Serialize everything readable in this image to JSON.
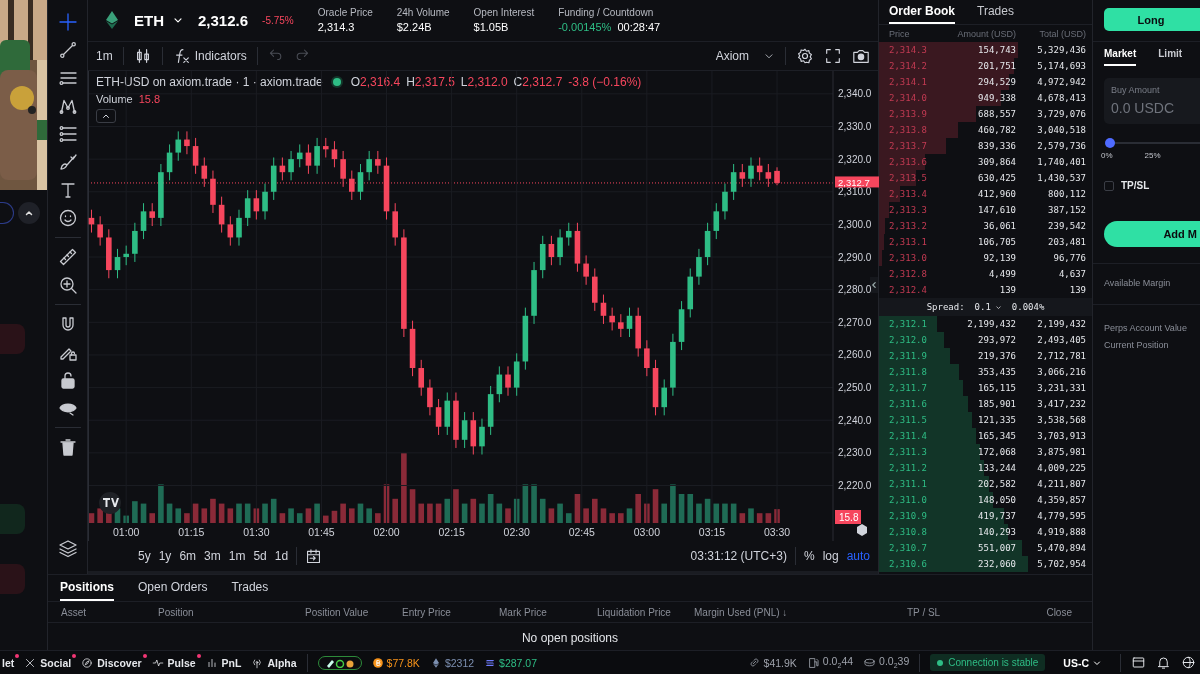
{
  "left_panel": {
    "thumbnail": {
      "kind": "picture"
    }
  },
  "market": {
    "symbol": "ETH",
    "price": "2,312.6",
    "change": "-5.75%",
    "stats": [
      {
        "label": "Oracle Price",
        "value": "2,314.3",
        "kind": "plain"
      },
      {
        "label": "24h Volume",
        "value": "$2.24B",
        "kind": "plain"
      },
      {
        "label": "Open Interest",
        "value": "$1.05B",
        "kind": "plain"
      },
      {
        "label": "Funding / Countdown",
        "value": "-0.00145%",
        "kind": "funding",
        "extra": "00:28:47"
      }
    ]
  },
  "toolbar": {
    "interval": "1m",
    "indicators": "Indicators",
    "layout": "Axiom"
  },
  "tool_groups": [
    [
      {
        "kind": "crosshair",
        "selected": true
      },
      {
        "kind": "line",
        "selected": false
      },
      {
        "kind": "hlines",
        "selected": false
      },
      {
        "kind": "pattern",
        "selected": false
      },
      {
        "kind": "fib",
        "selected": false
      },
      {
        "kind": "brush",
        "selected": false
      },
      {
        "kind": "text",
        "selected": false
      },
      {
        "kind": "smile",
        "selected": false
      }
    ],
    [
      {
        "kind": "ruler",
        "selected": false
      },
      {
        "kind": "zoom",
        "selected": false
      }
    ],
    [
      {
        "kind": "magnet",
        "selected": false
      },
      {
        "kind": "pencil-lock",
        "selected": false
      },
      {
        "kind": "lock",
        "selected": false
      },
      {
        "kind": "eye",
        "selected": false
      }
    ],
    [
      {
        "kind": "trash",
        "selected": false
      }
    ]
  ],
  "bottom_tools": [
    {
      "kind": "layers",
      "selected": false
    }
  ],
  "legend": {
    "title": "ETH-USD on axiom.trade · 1 · axiom.trade",
    "ohlc": [
      {
        "key": "O",
        "value": "2,316.4"
      },
      {
        "key": "H",
        "value": "2,317.5"
      },
      {
        "key": "L",
        "value": "2,312.0"
      },
      {
        "key": "C",
        "value": "2,312.7"
      }
    ],
    "change": "-3.8 (−0.16%)",
    "volume_label": "Volume",
    "volume_value": "15.8"
  },
  "chart": {
    "price_tag": "2,312.7",
    "volume_tag": "15.8",
    "chart_data": {
      "type": "candlestick",
      "grid": true,
      "ylim": [
        2203,
        2347
      ],
      "xlim": [
        51.2,
        222.9
      ],
      "x": [
        52,
        54,
        56,
        58,
        60,
        62,
        64,
        66,
        68,
        70,
        72,
        74,
        76,
        78,
        80,
        82,
        84,
        86,
        88,
        90,
        92,
        94,
        96,
        98,
        100,
        102,
        104,
        106,
        108,
        110,
        112,
        114,
        116,
        118,
        120,
        122,
        124,
        126,
        128,
        130,
        132,
        134,
        136,
        138,
        140,
        142,
        144,
        146,
        148,
        150,
        152,
        154,
        156,
        158,
        160,
        162,
        164,
        166,
        168,
        170,
        172,
        174,
        176,
        178,
        180,
        182,
        184,
        186,
        188,
        190,
        192,
        194,
        196,
        198,
        200,
        202,
        204,
        206,
        208,
        210
      ],
      "ohlc": [
        [
          2302,
          2304.5,
          2297.5,
          2300
        ],
        [
          2300,
          2302.5,
          2293.5,
          2296
        ],
        [
          2296,
          2298.5,
          2283.5,
          2286
        ],
        [
          2286,
          2292.5,
          2283.5,
          2290
        ],
        [
          2290,
          2293.5,
          2287.5,
          2291
        ],
        [
          2291,
          2300.5,
          2288.5,
          2298
        ],
        [
          2298,
          2306.5,
          2295.5,
          2304
        ],
        [
          2304,
          2306.5,
          2299.5,
          2302
        ],
        [
          2302,
          2318.5,
          2299.5,
          2316
        ],
        [
          2316,
          2324.5,
          2313.5,
          2322
        ],
        [
          2322,
          2328.5,
          2319.5,
          2326
        ],
        [
          2326,
          2328.5,
          2321.5,
          2324
        ],
        [
          2324,
          2326.5,
          2315.5,
          2318
        ],
        [
          2318,
          2320.5,
          2311.5,
          2314
        ],
        [
          2314,
          2316.5,
          2303.5,
          2306
        ],
        [
          2306,
          2308.5,
          2297.5,
          2300
        ],
        [
          2300,
          2302.5,
          2293.5,
          2296
        ],
        [
          2296,
          2304.5,
          2293.5,
          2302
        ],
        [
          2302,
          2310.5,
          2299.5,
          2308
        ],
        [
          2308,
          2310.5,
          2301.5,
          2304
        ],
        [
          2304,
          2312.5,
          2301.5,
          2310
        ],
        [
          2310,
          2320.5,
          2307.5,
          2318
        ],
        [
          2318,
          2320.5,
          2313.5,
          2316
        ],
        [
          2316,
          2322.5,
          2313.5,
          2320
        ],
        [
          2320,
          2324.5,
          2317.5,
          2322
        ],
        [
          2322,
          2324.5,
          2315.5,
          2318
        ],
        [
          2318,
          2326.5,
          2315.5,
          2324
        ],
        [
          2324,
          2326.5,
          2320.5,
          2323
        ],
        [
          2323,
          2325.5,
          2317.5,
          2320
        ],
        [
          2320,
          2322.5,
          2311.5,
          2314
        ],
        [
          2314,
          2316.5,
          2307.5,
          2310
        ],
        [
          2310,
          2318.5,
          2307.5,
          2316
        ],
        [
          2316,
          2322.5,
          2313.5,
          2320
        ],
        [
          2320,
          2322.5,
          2315.5,
          2318
        ],
        [
          2318,
          2320.5,
          2301.5,
          2304
        ],
        [
          2304,
          2306.5,
          2293.5,
          2296
        ],
        [
          2296,
          2298.5,
          2265.5,
          2268
        ],
        [
          2268,
          2270.5,
          2253.5,
          2256
        ],
        [
          2256,
          2258.5,
          2247.5,
          2250
        ],
        [
          2250,
          2252.5,
          2241.5,
          2244
        ],
        [
          2244,
          2246.5,
          2235.5,
          2238
        ],
        [
          2238,
          2248.5,
          2235.5,
          2246
        ],
        [
          2246,
          2248.5,
          2231.5,
          2234
        ],
        [
          2234,
          2242.5,
          2231.5,
          2240
        ],
        [
          2240,
          2242.5,
          2229.5,
          2232
        ],
        [
          2232,
          2240.5,
          2229.5,
          2238
        ],
        [
          2238,
          2250.5,
          2235.5,
          2248
        ],
        [
          2248,
          2256.5,
          2245.5,
          2254
        ],
        [
          2254,
          2256.5,
          2247.5,
          2250
        ],
        [
          2250,
          2260.5,
          2247.5,
          2258
        ],
        [
          2258,
          2274.5,
          2255.5,
          2272
        ],
        [
          2272,
          2288.5,
          2269.5,
          2286
        ],
        [
          2286,
          2296.5,
          2283.5,
          2294
        ],
        [
          2294,
          2296.5,
          2287.5,
          2290
        ],
        [
          2290,
          2298.5,
          2287.5,
          2296
        ],
        [
          2296,
          2300.5,
          2293.5,
          2298
        ],
        [
          2298,
          2300.5,
          2285.5,
          2288
        ],
        [
          2288,
          2290.5,
          2281.5,
          2284
        ],
        [
          2284,
          2286.5,
          2273.5,
          2276
        ],
        [
          2276,
          2278.5,
          2269.5,
          2272
        ],
        [
          2272,
          2274.5,
          2267.5,
          2270
        ],
        [
          2270,
          2272.5,
          2265.5,
          2268
        ],
        [
          2268,
          2274.5,
          2265.5,
          2272
        ],
        [
          2272,
          2274.5,
          2259.5,
          2262
        ],
        [
          2262,
          2264.5,
          2253.5,
          2256
        ],
        [
          2256,
          2258.5,
          2241.5,
          2244
        ],
        [
          2244,
          2252.5,
          2241.5,
          2250
        ],
        [
          2250,
          2266.5,
          2247.5,
          2264
        ],
        [
          2264,
          2276.5,
          2261.5,
          2274
        ],
        [
          2274,
          2286.5,
          2271.5,
          2284
        ],
        [
          2284,
          2292.5,
          2281.5,
          2290
        ],
        [
          2290,
          2300.5,
          2287.5,
          2298
        ],
        [
          2298,
          2306.5,
          2295.5,
          2304
        ],
        [
          2304,
          2312.5,
          2301.5,
          2310
        ],
        [
          2310,
          2318.5,
          2307.5,
          2316
        ],
        [
          2316,
          2318.5,
          2311.5,
          2314
        ],
        [
          2314,
          2320.5,
          2311.5,
          2318
        ],
        [
          2318,
          2320.5,
          2313.5,
          2316
        ],
        [
          2316,
          2318.5,
          2311.5,
          2314
        ],
        [
          2316.4,
          2317.5,
          2312.0,
          2312.7
        ]
      ],
      "yticks": [
        {
          "value": 2340,
          "label": "2,340.0"
        },
        {
          "value": 2330,
          "label": "2,330.0"
        },
        {
          "value": 2320,
          "label": "2,320.0"
        },
        {
          "value": 2310,
          "label": "2,310.0"
        },
        {
          "value": 2300,
          "label": "2,300.0"
        },
        {
          "value": 2290,
          "label": "2,290.0"
        },
        {
          "value": 2280,
          "label": "2,280.0"
        },
        {
          "value": 2270,
          "label": "2,270.0"
        },
        {
          "value": 2260,
          "label": "2,260.0"
        },
        {
          "value": 2250,
          "label": "2,250.0"
        },
        {
          "value": 2240,
          "label": "2,240.0"
        },
        {
          "value": 2230,
          "label": "2,230.0"
        },
        {
          "value": 2220,
          "label": "2,220.0"
        }
      ],
      "xticks": [
        {
          "value": 60,
          "label": "01:00"
        },
        {
          "value": 75,
          "label": "01:15"
        },
        {
          "value": 90,
          "label": "01:30"
        },
        {
          "value": 105,
          "label": "01:45"
        },
        {
          "value": 120,
          "label": "02:00"
        },
        {
          "value": 135,
          "label": "02:15"
        },
        {
          "value": 150,
          "label": "02:30"
        },
        {
          "value": 165,
          "label": "02:45"
        },
        {
          "value": 180,
          "label": "03:00"
        },
        {
          "value": 195,
          "label": "03:15"
        },
        {
          "value": 210,
          "label": "03:30"
        }
      ]
    }
  },
  "range_bar": {
    "ranges": [
      "5y",
      "1y",
      "6m",
      "3m",
      "1m",
      "5d",
      "1d"
    ],
    "time": "03:31:12 (UTC+3)",
    "scales": [
      {
        "label": "%",
        "on": false
      },
      {
        "label": "log",
        "on": false
      },
      {
        "label": "auto",
        "on": true
      }
    ]
  },
  "positions": {
    "tabs": [
      {
        "label": "Positions",
        "selected": true
      },
      {
        "label": "Open Orders",
        "selected": false
      },
      {
        "label": "Trades",
        "selected": false
      }
    ],
    "columns": [
      "Asset",
      "Position",
      "Position Value",
      "Entry Price",
      "Mark Price",
      "Liquidation Price",
      "Margin Used (PNL) ↓",
      "TP / SL",
      "Close"
    ],
    "empty": "No open positions"
  },
  "order_book": {
    "tabs": [
      {
        "label": "Order Book",
        "selected": true
      },
      {
        "label": "Trades",
        "selected": false
      }
    ],
    "columns": [
      "Price",
      "Amount (USD)",
      "Total (USD)"
    ],
    "asks": [
      {
        "price": "2,314.3",
        "amount": "154,743",
        "total": "5,329,436"
      },
      {
        "price": "2,314.2",
        "amount": "201,751",
        "total": "5,174,693"
      },
      {
        "price": "2,314.1",
        "amount": "294,529",
        "total": "4,972,942"
      },
      {
        "price": "2,314.0",
        "amount": "949,338",
        "total": "4,678,413"
      },
      {
        "price": "2,313.9",
        "amount": "688,557",
        "total": "3,729,076"
      },
      {
        "price": "2,313.8",
        "amount": "460,782",
        "total": "3,040,518"
      },
      {
        "price": "2,313.7",
        "amount": "839,336",
        "total": "2,579,736"
      },
      {
        "price": "2,313.6",
        "amount": "309,864",
        "total": "1,740,401"
      },
      {
        "price": "2,313.5",
        "amount": "630,425",
        "total": "1,430,537"
      },
      {
        "price": "2,313.4",
        "amount": "412,960",
        "total": "800,112"
      },
      {
        "price": "2,313.3",
        "amount": "147,610",
        "total": "387,152"
      },
      {
        "price": "2,313.2",
        "amount": "36,061",
        "total": "239,542"
      },
      {
        "price": "2,313.1",
        "amount": "106,705",
        "total": "203,481"
      },
      {
        "price": "2,313.0",
        "amount": "92,139",
        "total": "96,776"
      },
      {
        "price": "2,312.8",
        "amount": "4,499",
        "total": "4,637"
      },
      {
        "price": "2,312.4",
        "amount": "139",
        "total": "139"
      }
    ],
    "spread": {
      "label": "Spread:",
      "value": "0.1",
      "percent": "0.004%"
    },
    "bids": [
      {
        "price": "2,312.1",
        "amount": "2,199,432",
        "total": "2,199,432"
      },
      {
        "price": "2,312.0",
        "amount": "293,972",
        "total": "2,493,405"
      },
      {
        "price": "2,311.9",
        "amount": "219,376",
        "total": "2,712,781"
      },
      {
        "price": "2,311.8",
        "amount": "353,435",
        "total": "3,066,216"
      },
      {
        "price": "2,311.7",
        "amount": "165,115",
        "total": "3,231,331"
      },
      {
        "price": "2,311.6",
        "amount": "185,901",
        "total": "3,417,232"
      },
      {
        "price": "2,311.5",
        "amount": "121,335",
        "total": "3,538,568"
      },
      {
        "price": "2,311.4",
        "amount": "165,345",
        "total": "3,703,913"
      },
      {
        "price": "2,311.3",
        "amount": "172,068",
        "total": "3,875,981"
      },
      {
        "price": "2,311.2",
        "amount": "133,244",
        "total": "4,009,225"
      },
      {
        "price": "2,311.1",
        "amount": "202,582",
        "total": "4,211,807"
      },
      {
        "price": "2,311.0",
        "amount": "148,050",
        "total": "4,359,857"
      },
      {
        "price": "2,310.9",
        "amount": "419,737",
        "total": "4,779,595"
      },
      {
        "price": "2,310.8",
        "amount": "140,293",
        "total": "4,919,888"
      },
      {
        "price": "2,310.7",
        "amount": "551,007",
        "total": "5,470,894"
      },
      {
        "price": "2,310.6",
        "amount": "232,060",
        "total": "5,702,954"
      }
    ]
  },
  "trade_panel": {
    "side_button": "Long",
    "order_tabs": [
      {
        "label": "Market",
        "selected": true
      },
      {
        "label": "Limit",
        "selected": false
      }
    ],
    "amount": {
      "label": "Buy Amount",
      "placeholder": "0.0 USDC"
    },
    "slider": {
      "level": 0,
      "ticks": [
        "0%",
        "25%"
      ]
    },
    "tpsl": {
      "label": "TP/SL",
      "checked": false
    },
    "submit": "Add M",
    "info": [
      "Available Margin",
      "Perps Account Value",
      "Current Position"
    ]
  },
  "status_bar": {
    "left": [
      {
        "label": "let",
        "badge": true
      },
      {
        "label": "Social",
        "badge": true,
        "kind": "x"
      },
      {
        "label": "Discover",
        "badge": true,
        "kind": "compass"
      },
      {
        "label": "Pulse",
        "badge": true,
        "kind": "pulse"
      },
      {
        "label": "PnL",
        "badge": false,
        "kind": "bars"
      },
      {
        "label": "Alpha",
        "badge": false,
        "kind": "signal"
      }
    ],
    "prices": [
      {
        "value": "$77.8K",
        "kind": "btc"
      },
      {
        "value": "$2312",
        "kind": "eth"
      },
      {
        "value": "$287.07",
        "kind": "sol"
      }
    ],
    "right": [
      {
        "value": "$41.9K",
        "kind": "link"
      },
      {
        "value": "0.0$_{2}$44",
        "kind": "gas"
      },
      {
        "value": "0.0$_{2}$39",
        "kind": "coin"
      }
    ],
    "connection": "Connection is stable",
    "region": "US-C"
  }
}
